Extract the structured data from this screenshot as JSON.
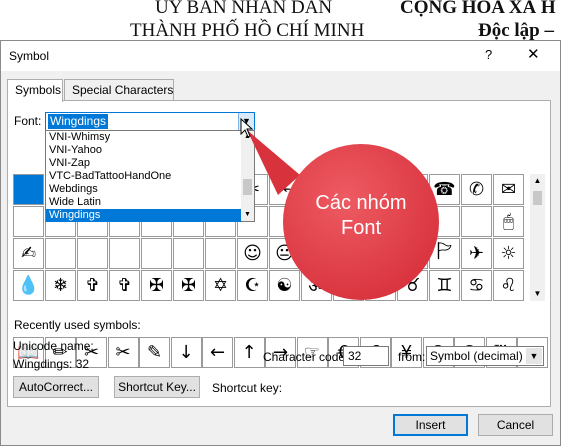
{
  "background_doc": {
    "left_line1": "ỦY BAN NHÂN DÂN",
    "left_line2": "THÀNH PHỐ HỒ CHÍ MINH",
    "right_line1": "CỘNG HÒA XÃ H",
    "right_line2": "Độc lập –"
  },
  "dialog": {
    "title": "Symbol",
    "help_icon": "?",
    "close_icon": "✕",
    "tabs": [
      {
        "label": "Symbols",
        "active": true
      },
      {
        "label": "Special Characters",
        "active": false
      }
    ],
    "font_label": "Font:",
    "font_value": "Wingdings",
    "font_dropdown_items": [
      {
        "label": "VNI-Whimsy",
        "selected": false
      },
      {
        "label": "VNI-Yahoo",
        "selected": false
      },
      {
        "label": "VNI-Zap",
        "selected": false
      },
      {
        "label": "VTC-BadTattooHandOne",
        "selected": false
      },
      {
        "label": "Webdings",
        "selected": false
      },
      {
        "label": "Wide Latin",
        "selected": false
      },
      {
        "label": "Wingdings",
        "selected": true
      }
    ],
    "symbol_rows": [
      [
        "",
        "",
        "",
        "",
        "",
        "",
        "",
        "✂",
        "✁",
        "👓",
        "🔔",
        "📖",
        "🕯",
        "☎",
        "✆",
        "✉",
        "✉",
        "📪",
        "📫",
        "📬",
        "📭",
        "📁",
        "📂"
      ],
      [
        "",
        "",
        "",
        "",
        "",
        "",
        "",
        "",
        "",
        "",
        "",
        "",
        "",
        "",
        "",
        "🖱",
        "💻",
        "🖱",
        "💾",
        "👍",
        "👎",
        "✌",
        "✌"
      ],
      [
        "✍",
        "",
        "",
        "",
        "",
        "",
        "",
        "☺",
        "😐",
        "☹",
        "💣",
        "☠",
        "🏳",
        "🏱",
        "✈",
        "☼",
        "",
        "",
        "",
        "",
        "",
        "",
        ""
      ],
      [
        "💧",
        "❄",
        "✞",
        "✞",
        "✠",
        "✠",
        "✡",
        "☪",
        "☯",
        "ॐ",
        "☸",
        "♈",
        "♉",
        "♊",
        "♋",
        "♌",
        "♍",
        "",
        "",
        "",
        "",
        "",
        ""
      ]
    ],
    "recent_label": "Recently used symbols:",
    "recent_symbols": [
      "📖",
      "✏",
      "✂",
      "✂",
      "✎",
      "↓",
      "←",
      "↑",
      "→",
      "☞",
      "€",
      "£",
      "¥",
      "©",
      "®",
      "™",
      "±"
    ],
    "unicode_name_label": "Unicode name:",
    "unicode_name_value": "Wingdings: 32",
    "char_code_label": "Character code:",
    "char_code_value": "32",
    "from_label": "from:",
    "from_value": "Symbol (decimal)",
    "autocorrect_label": "AutoCorrect...",
    "shortcut_key_button": "Shortcut Key...",
    "shortcut_key_label": "Shortcut key:",
    "insert_label": "Insert",
    "cancel_label": "Cancel"
  },
  "callout": {
    "line1": "Các nhóm",
    "line2": "Font",
    "color": "#e84a52"
  },
  "colors": {
    "accent": "#0078d7",
    "dialog_bg": "#f0f0f0"
  }
}
